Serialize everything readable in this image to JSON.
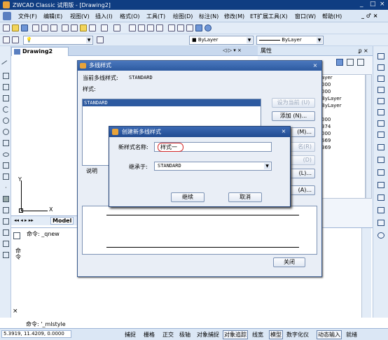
{
  "window": {
    "title": "ZWCAD Classic 试用版 - [Drawing2]",
    "controls": [
      "_",
      "□",
      "×"
    ]
  },
  "menu": {
    "items": [
      "文件(F)",
      "编辑(E)",
      "视图(V)",
      "插入(I)",
      "格式(O)",
      "工具(T)",
      "绘图(D)",
      "标注(N)",
      "修改(M)",
      "ET扩展工具(X)",
      "窗口(W)",
      "帮助(H)"
    ],
    "doc_controls": "_ ♂ ×"
  },
  "toolbar": {
    "layer_color": "■",
    "bylayer_color": "ByLayer",
    "bylayer_linetype": "ByLayer"
  },
  "drawing_tab": {
    "label": "Drawing2",
    "nav": "◁ ▷ ▾ ×"
  },
  "properties": {
    "title": "属性",
    "pin": "ᵱ ×",
    "rows": [
      "ayer",
      "000",
      "000",
      "ByLayer",
      "ByLayer",
      "",
      "000",
      "374",
      "000",
      "669",
      "369"
    ]
  },
  "layout_tabs": {
    "nav": "◂◂ ◂ ▸ ▸▸",
    "model": "Model"
  },
  "axis": {
    "y": "Y",
    "x": "X"
  },
  "command": {
    "prompt": "命令: _qnew",
    "input_label": "命令:",
    "input_value": "'_mlstyle"
  },
  "side_label": "命令",
  "status": {
    "coords": "5.3919, 11.4209, 0.0000",
    "buttons": [
      "捕捉",
      "栅格",
      "正交",
      "极轴",
      "对象捕捉",
      "对象追踪",
      "线宽",
      "模型",
      "数字化仪",
      "动态输入",
      "就绪"
    ],
    "active": [
      "对象追踪",
      "模型",
      "动态输入"
    ]
  },
  "mlstyle_dialog": {
    "title": "多线样式",
    "current_label": "当前多线样式:",
    "current_value": "STANDARD",
    "styles_label": "样式:",
    "styles": [
      "STANDARD"
    ],
    "set_current": "设为当前 (U)",
    "new": "添加 (N)...",
    "modify": "(M)...",
    "rename": "名(R)",
    "delete": "(D)",
    "load": "(L)...",
    "save": "(A)...",
    "desc_label": "说明",
    "close": "关闭"
  },
  "new_dialog": {
    "title": "创建新多线样式",
    "name_label": "新样式名称:",
    "name_value": "样式一",
    "base_label": "继承于:",
    "base_value": "STANDARD",
    "continue": "继续",
    "cancel": "取消"
  }
}
